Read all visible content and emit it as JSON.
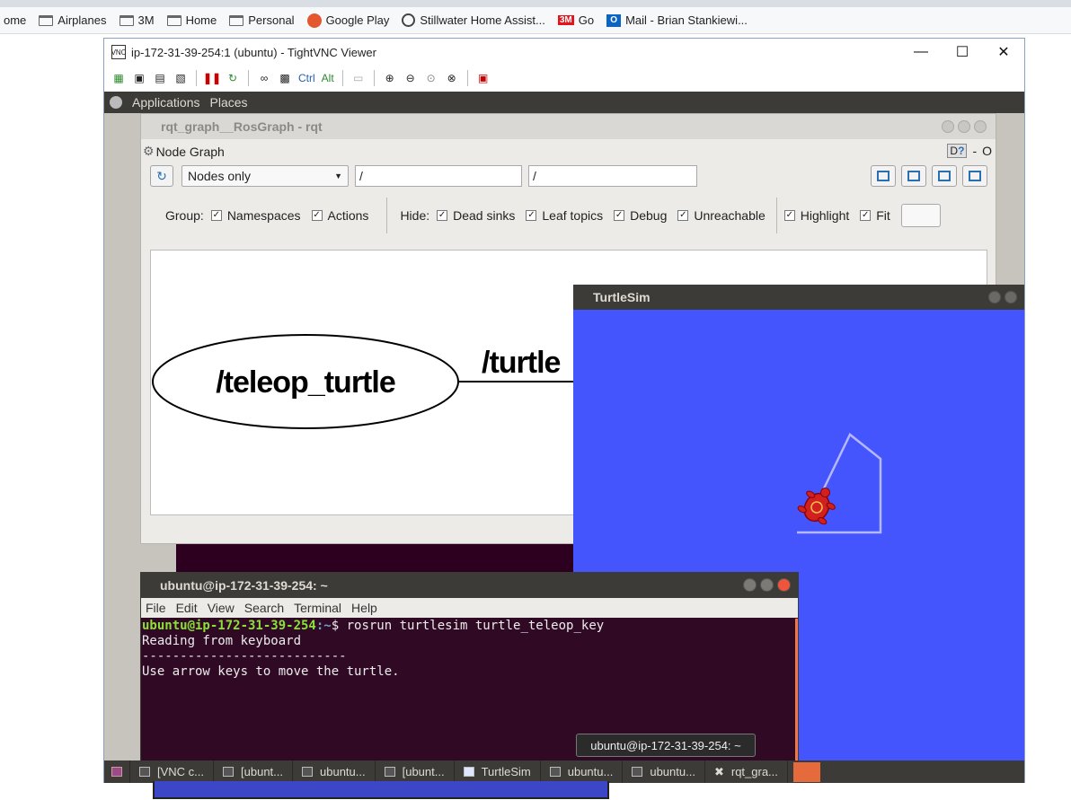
{
  "browser_bookmarks": {
    "items": [
      {
        "label": "ome",
        "icon": "folder-icon"
      },
      {
        "label": "Airplanes",
        "icon": "folder-icon"
      },
      {
        "label": "3M",
        "icon": "folder-icon"
      },
      {
        "label": "Home",
        "icon": "folder-icon"
      },
      {
        "label": "Personal",
        "icon": "folder-icon"
      },
      {
        "label": "Google Play",
        "icon": "google-play-icon"
      },
      {
        "label": "Stillwater Home Assist...",
        "icon": "globe-icon"
      },
      {
        "label": "Go",
        "icon": "3m-logo-icon"
      },
      {
        "label": "Mail - Brian Stankiewi...",
        "icon": "outlook-icon"
      }
    ]
  },
  "vnc_window": {
    "title": "ip-172-31-39-254:1 (ubuntu) - TightVNC Viewer",
    "toolbar_text": {
      "ctrl": "Ctrl",
      "alt": "Alt"
    }
  },
  "gnome_panel": {
    "applications": "Applications",
    "places": "Places"
  },
  "rqt": {
    "title": "rqt_graph__RosGraph - rqt",
    "plugin_label": "Node Graph",
    "plugin_right": {
      "d": "D",
      "help": "?",
      "dash": "-",
      "o": "O"
    },
    "combo_value": "Nodes only",
    "filter1": "/",
    "filter2": "/",
    "group_label": "Group:",
    "group_opts": [
      "Namespaces",
      "Actions"
    ],
    "hide_label": "Hide:",
    "hide_opts": [
      "Dead sinks",
      "Leaf topics",
      "Debug",
      "Unreachable"
    ],
    "view_opts": [
      "Highlight",
      "Fit"
    ],
    "graph": {
      "node": "/teleop_turtle",
      "edge_label": "/turtle"
    }
  },
  "turtlesim": {
    "title": "TurtleSim",
    "bg_color": "#4555fe",
    "pen_color": "#b3b8ff"
  },
  "terminal": {
    "title": "ubuntu@ip-172-31-39-254: ~",
    "menu": [
      "File",
      "Edit",
      "View",
      "Search",
      "Terminal",
      "Help"
    ],
    "prompt_user": "ubuntu@ip-172-31-39-254",
    "prompt_path": ":~",
    "prompt_symbol": "$ ",
    "command": "rosrun turtlesim turtle_teleop_key",
    "lines": [
      "Reading from keyboard",
      "---------------------------",
      "Use arrow keys to move the turtle."
    ]
  },
  "tooltip": "ubuntu@ip-172-31-39-254: ~",
  "taskbar": {
    "tasks": [
      "[VNC c...",
      "[ubunt...",
      "ubuntu...",
      "[ubunt...",
      "TurtleSim",
      "ubuntu...",
      "ubuntu...",
      "rqt_gra..."
    ]
  }
}
